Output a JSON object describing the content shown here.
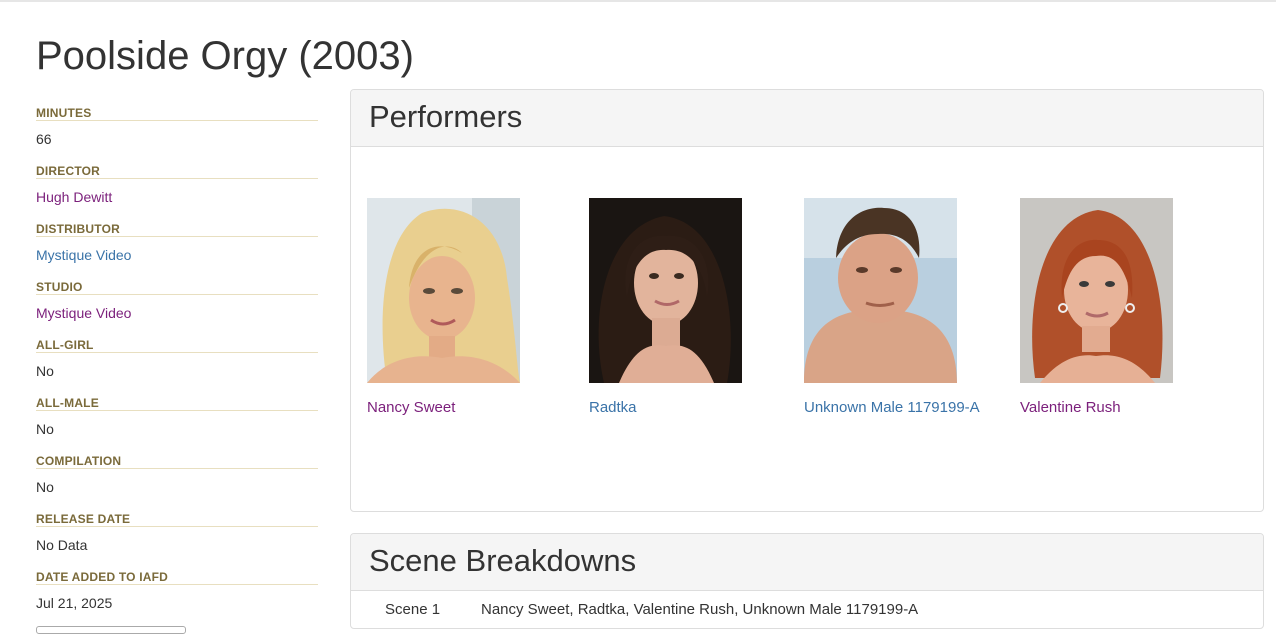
{
  "page": {
    "title": "Poolside Orgy (2003)"
  },
  "sidebar": {
    "fields": [
      {
        "label": "MINUTES",
        "value": "66"
      },
      {
        "label": "DIRECTOR",
        "value": "Hugh Dewitt"
      },
      {
        "label": "DISTRIBUTOR",
        "value": "Mystique Video"
      },
      {
        "label": "STUDIO",
        "value": "Mystique Video"
      },
      {
        "label": "ALL-GIRL",
        "value": "No"
      },
      {
        "label": "ALL-MALE",
        "value": "No"
      },
      {
        "label": "COMPILATION",
        "value": "No"
      },
      {
        "label": "RELEASE DATE",
        "value": "No Data"
      },
      {
        "label": "DATE ADDED TO IAFD",
        "value": "Jul 21, 2025"
      }
    ]
  },
  "performers": {
    "heading": "Performers",
    "items": [
      {
        "name": "Nancy Sweet"
      },
      {
        "name": "Radtka"
      },
      {
        "name": "Unknown Male 1179199-A"
      },
      {
        "name": "Valentine Rush"
      }
    ]
  },
  "scenes": {
    "heading": "Scene Breakdowns",
    "rows": [
      {
        "label": "Scene 1",
        "cast": "Nancy Sweet, Radtka, Valentine Rush, Unknown Male 1179199-A"
      }
    ]
  },
  "colors": {
    "link_visited": "#7b1f7b",
    "link": "#3a73a8",
    "label": "#7a6a3a"
  }
}
